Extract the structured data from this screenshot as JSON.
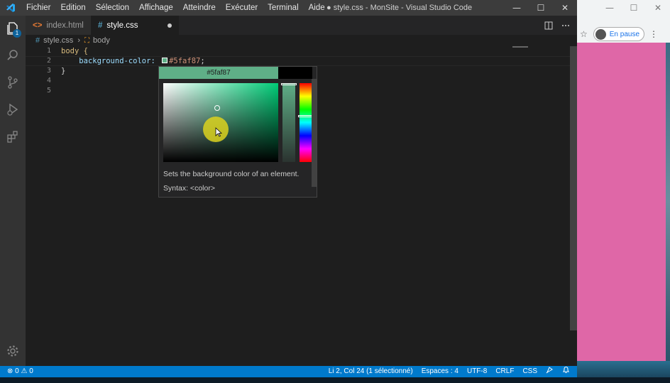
{
  "titlebar": {
    "menu": [
      "Fichier",
      "Edition",
      "Sélection",
      "Affichage",
      "Atteindre",
      "Exécuter",
      "Terminal",
      "Aide"
    ],
    "title": "● style.css - MonSite - Visual Studio Code",
    "minimize": "—",
    "maximize": "☐",
    "close": "✕"
  },
  "activitybar": {
    "icons": [
      "explorer-icon",
      "search-icon",
      "source-control-icon",
      "run-debug-icon",
      "extensions-icon",
      "settings-gear-icon"
    ],
    "explorer_badge": "1"
  },
  "tabs": [
    {
      "label": "index.html",
      "icon": "<>",
      "active": false
    },
    {
      "label": "style.css",
      "icon": "#",
      "active": true,
      "dirty": true
    }
  ],
  "breadcrumb": {
    "file": "style.css",
    "symbol": "body"
  },
  "editor": {
    "line_numbers": [
      "1",
      "2",
      "3",
      "4",
      "5"
    ],
    "lines": {
      "l1": "body {",
      "l2_prop": "background-color:",
      "l2_val": "#5faf87",
      "l2_end": ";",
      "l3": "}"
    }
  },
  "color_picker": {
    "hex": "#5faf87",
    "color": "#5faf87",
    "original_color": "#000000",
    "description": "Sets the background color of an element.",
    "syntax": "Syntax: <color>",
    "hue_fraction": 0.42,
    "opacity_fraction": 0.0
  },
  "statusbar": {
    "problems": "⊗ 0 ⚠ 0",
    "position": "Li 2, Col 24 (1 sélectionné)",
    "spaces": "Espaces : 4",
    "encoding": "UTF-8",
    "eol": "CRLF",
    "language": "CSS"
  },
  "browser": {
    "minimize": "—",
    "maximize": "☐",
    "close": "✕",
    "profile_label": "En pause",
    "page_color": "#df67a7"
  }
}
